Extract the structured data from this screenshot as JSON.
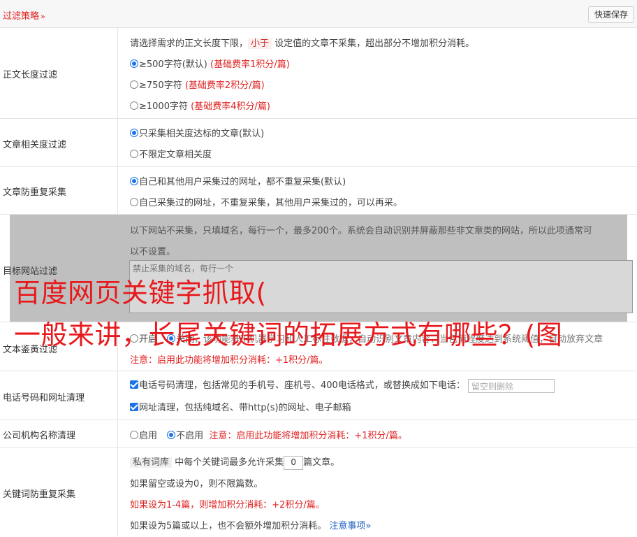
{
  "header": {
    "title": "过滤策略",
    "chevron": "»",
    "save_label": "快速保存"
  },
  "length_filter": {
    "label": "正文长度过滤",
    "desc_pre": "请选择需求的正文长度下限，",
    "desc_pill": "小于",
    "desc_post": "设定值的文章不采集，超出部分不增加积分消耗。",
    "options": [
      {
        "text": "≥500字符(默认)",
        "note": "(基础费率1积分/篇)",
        "checked": true
      },
      {
        "text": "≥750字符",
        "note": "(基础费率2积分/篇)",
        "checked": false
      },
      {
        "text": "≥1000字符",
        "note": "(基础费率4积分/篇)",
        "checked": false
      }
    ]
  },
  "relevance": {
    "label": "文章相关度过滤",
    "options": [
      {
        "text": "只采集相关度达标的文章(默认)",
        "checked": true
      },
      {
        "text": "不限定文章相关度",
        "checked": false
      }
    ]
  },
  "duplicate": {
    "label": "文章防重复采集",
    "options": [
      {
        "text": "自己和其他用户采集过的网址，都不重复采集(默认)",
        "checked": true
      },
      {
        "text": "自己采集过的网址，不重复采集，其他用户采集过的，可以再采。",
        "checked": false
      }
    ]
  },
  "target_site": {
    "label": "目标网站过滤",
    "desc_1": "以下网站不采集，只填域名，每行一个，最多200个。系统会自动识别并屏蔽那些非文章类的网站，所以此项通常可",
    "desc_2": "以不设置。",
    "placeholder": "禁止采集的域名，每行一个"
  },
  "text_review": {
    "label": "文本鉴黄过滤",
    "opt_on": "开启",
    "opt_off": "关闭",
    "visible_desc": "，该功能基于机器学习和人工标注数据，自动识别文章内容，当色情程度达到系统阈值，自动放弃文章",
    "note": "注意：启用此功能将增加积分消耗：+1积分/篇。"
  },
  "phone_url": {
    "label": "电话号码和网址清理",
    "phone_text": "电话号码清理，包括常见的手机号、座机号、400电话格式，或替换成如下电话：",
    "phone_placeholder": "留空则删除",
    "url_text": "网址清理，包括纯域名、带http(s)的网址、电子邮箱"
  },
  "company": {
    "label": "公司机构名称清理",
    "opt_on": "启用",
    "opt_off": "不启用",
    "note": "注意：启用此功能将增加积分消耗：+1积分/篇。"
  },
  "keyword_dup": {
    "label": "关键词防重复采集",
    "pill": "私有词库",
    "line1_pre": "中每个关键词最多允许采集",
    "count": "0",
    "line1_post": "篇文章。",
    "line2": "如果留空或设为0，则不限篇数。",
    "line3": "如果设为1-4篇，则增加积分消耗：+2积分/篇。",
    "line4": "如果设为5篇或以上，也不会额外增加积分消耗。",
    "notice_link": "注意事项",
    "notice_chevron": "»"
  },
  "overlay": {
    "line1": "百度网页关键字抓取(",
    "line2": "一般来讲，长尾关键词的拓展方式有哪些？(图"
  },
  "colors": {
    "accent_red": "#e02020",
    "overlay_red": "#e8191c",
    "radio_blue": "#1a73e8",
    "link_blue": "#1f5fbf",
    "panel_gray": "#bfbfbf"
  }
}
